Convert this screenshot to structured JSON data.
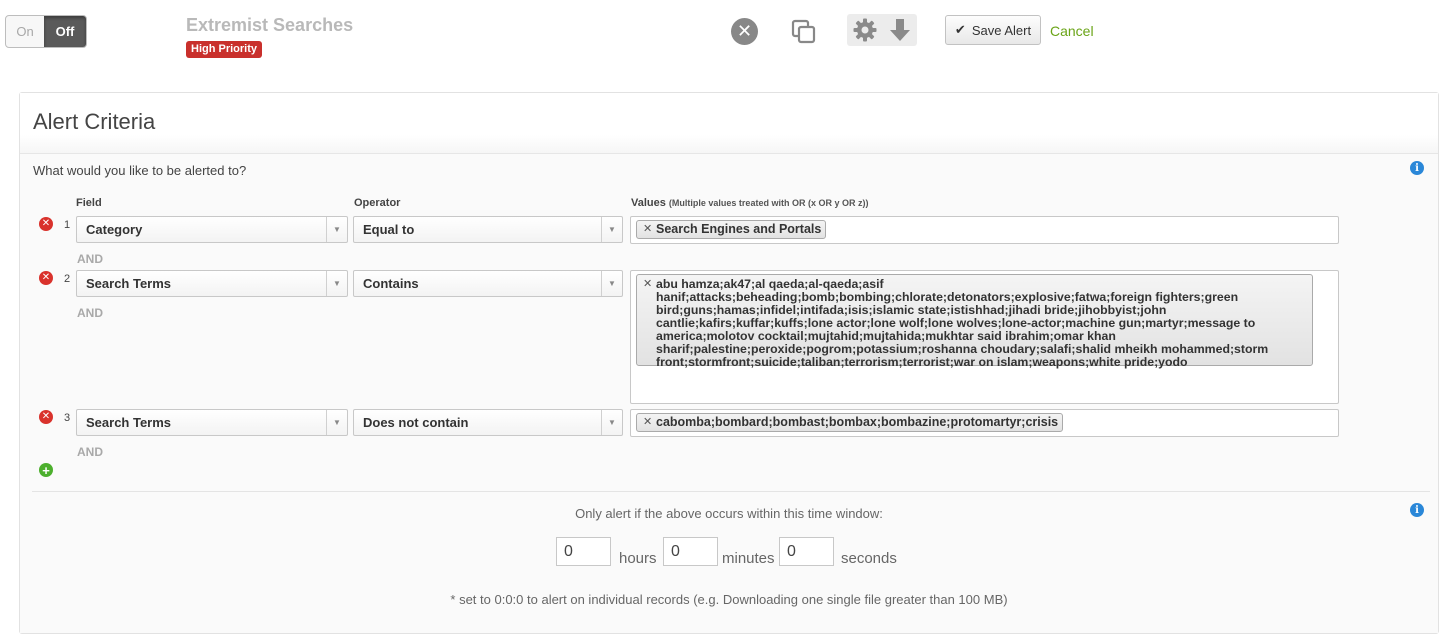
{
  "toggle": {
    "on_label": "On",
    "off_label": "Off",
    "state": "off"
  },
  "alert": {
    "title": "Extremist Searches",
    "priority": "High Priority"
  },
  "toolbar": {
    "save_label": "Save Alert",
    "cancel_label": "Cancel"
  },
  "panel": {
    "title": "Alert Criteria",
    "question": "What would you like to be alerted to?",
    "headers": {
      "field": "Field",
      "operator": "Operator",
      "values": "Values",
      "values_note": "(Multiple values treated with OR (x OR y OR z))"
    },
    "rows": [
      {
        "num": "1",
        "field": "Category",
        "operator": "Equal to",
        "values": [
          "Search Engines and Portals"
        ],
        "and": "AND"
      },
      {
        "num": "2",
        "field": "Search Terms",
        "operator": "Contains",
        "values": [
          "abu hamza;ak47;al qaeda;al-qaeda;asif hanif;attacks;beheading;bomb;bombing;chlorate;detonators;explosive;fatwa;foreign fighters;green bird;guns;hamas;infidel;intifada;isis;islamic state;istishhad;jihadi bride;jihobbyist;john cantlie;kafirs;kuffar;kuffs;lone actor;lone wolf;lone wolves;lone-actor;machine gun;martyr;message to america;molotov cocktail;mujtahid;mujtahida;mukhtar said ibrahim;omar khan sharif;palestine;peroxide;pogrom;potassium;roshanna choudary;salafi;shalid mheikh mohammed;storm front;stormfront;suicide;taliban;terrorism;terrorist;war on islam;weapons;white pride;yodo"
        ],
        "and": "AND"
      },
      {
        "num": "3",
        "field": "Search Terms",
        "operator": "Does not contain",
        "values": [
          "cabomba;bombard;bombast;bombax;bombazine;protomartyr;crisis"
        ],
        "and": "AND"
      }
    ],
    "time_window": {
      "label": "Only alert if the above occurs within this time window:",
      "hours": "0",
      "hours_label": "hours",
      "minutes": "0",
      "minutes_label": "minutes",
      "seconds": "0",
      "seconds_label": "seconds",
      "footnote": "* set to 0:0:0 to alert on individual records (e.g. Downloading one single file greater than 100 MB)"
    }
  },
  "colors": {
    "priority": "#c9302c",
    "cancel": "#6aa417",
    "remove": "#d9322c",
    "add": "#4caf2d",
    "info": "#2a87d8"
  }
}
